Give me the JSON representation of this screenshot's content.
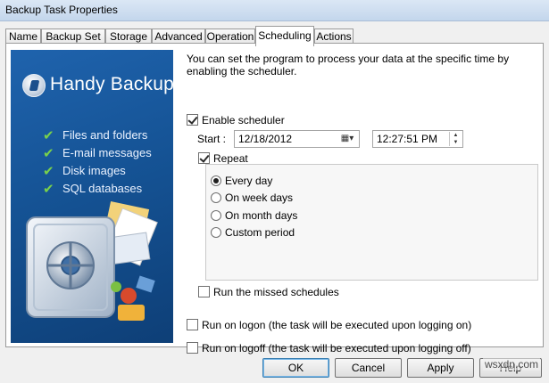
{
  "window": {
    "title": "Backup Task Properties"
  },
  "tabs": [
    {
      "label": "Name"
    },
    {
      "label": "Backup Set"
    },
    {
      "label": "Storage"
    },
    {
      "label": "Advanced"
    },
    {
      "label": "Operation"
    },
    {
      "label": "Scheduling",
      "active": true
    },
    {
      "label": "Actions"
    }
  ],
  "brand": {
    "title": "Handy Backup",
    "features": [
      "Files and folders",
      "E-mail messages",
      "Disk images",
      "SQL databases"
    ],
    "accent_color": "#155395",
    "check_color": "#79d14b"
  },
  "scheduling": {
    "description": "You can set the program to process your data at the specific time by enabling the scheduler.",
    "enable_scheduler": {
      "label": "Enable scheduler",
      "checked": true
    },
    "start": {
      "label": "Start :",
      "date": "12/18/2012",
      "time": "12:27:51 PM"
    },
    "repeat": {
      "label": "Repeat",
      "checked": true
    },
    "repeat_options": [
      {
        "label": "Every day",
        "selected": true
      },
      {
        "label": "On week days",
        "selected": false
      },
      {
        "label": "On month days",
        "selected": false
      },
      {
        "label": "Custom period",
        "selected": false
      }
    ],
    "run_missed": {
      "label": "Run the missed schedules",
      "checked": false
    },
    "run_on_logon": {
      "label": "Run on logon (the task will be executed upon logging on)",
      "checked": false
    },
    "run_on_logoff": {
      "label": "Run on logoff (the task will be executed upon logging off)",
      "checked": false
    }
  },
  "buttons": {
    "ok": "OK",
    "cancel": "Cancel",
    "apply": "Apply",
    "help": "Help"
  },
  "watermark": "wsxdn.com"
}
